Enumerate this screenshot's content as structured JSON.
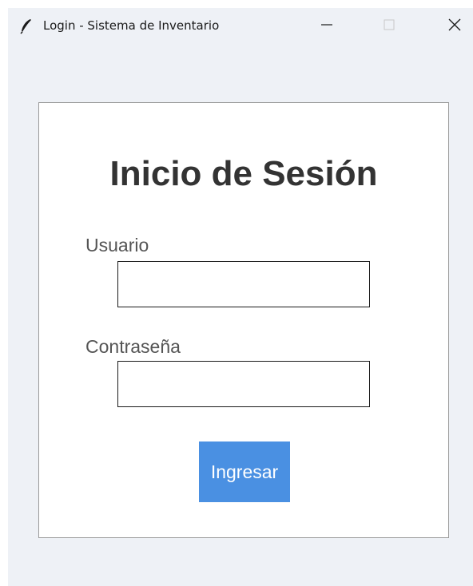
{
  "window": {
    "title": "Login - Sistema de Inventario",
    "icon": "feather-icon",
    "controls": [
      "minimize-icon",
      "maximize-icon",
      "close-icon"
    ]
  },
  "login": {
    "heading": "Inicio de Sesión",
    "username_label": "Usuario",
    "username_value": "",
    "password_label": "Contraseña",
    "password_value": "",
    "submit_label": "Ingresar"
  },
  "colors": {
    "window_bg": "#eef1f6",
    "panel_bg": "#ffffff",
    "heading": "#333333",
    "label": "#555555",
    "button_bg": "#4a90e2",
    "button_text": "#ffffff"
  }
}
